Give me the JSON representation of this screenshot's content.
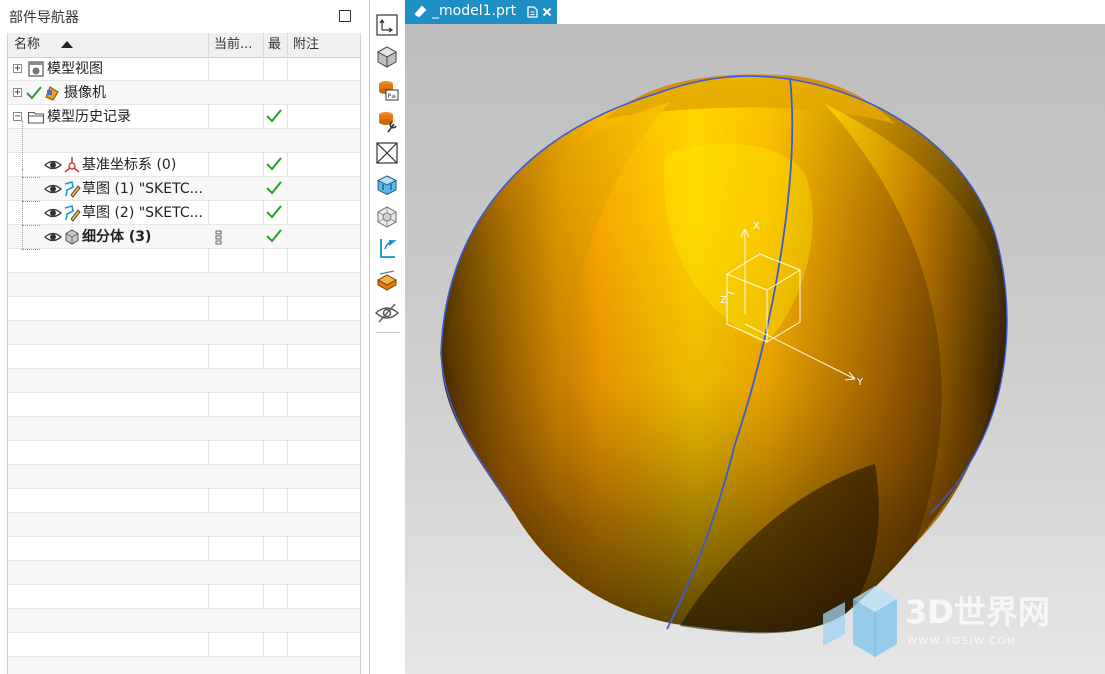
{
  "navigator": {
    "title": "部件导航器",
    "columns": [
      "名称",
      "当前...",
      "最",
      "附注"
    ],
    "rows": [
      {
        "label": "模型视图",
        "expander": "+",
        "icon": "model-views-icon",
        "checked": false
      },
      {
        "label": "摄像机",
        "expander": "+",
        "icon": "camera-icon",
        "checked": false
      },
      {
        "label": "模型历史记录",
        "expander": "−",
        "icon": "folder-icon",
        "checked": true
      },
      {
        "label": "基准坐标系 (0)",
        "icon": "datum-csys-icon",
        "checked": true
      },
      {
        "label": "草图 (1) \"SKETC...",
        "icon": "sketch-icon",
        "checked": true
      },
      {
        "label": "草图 (2) \"SKETC...",
        "icon": "sketch-icon",
        "checked": true
      },
      {
        "label": "细分体 (3)",
        "icon": "subdivision-body-icon",
        "checked": true,
        "bold": true
      }
    ]
  },
  "toolbar": {
    "buttons": [
      "orient-view-icon",
      "shaded-view-icon",
      "part-file-icon",
      "edit-settings-icon",
      "hide-icon",
      "view-triad-icon",
      "wireframe-icon",
      "undo-orient-icon",
      "section-view-icon",
      "show-hide-icon"
    ]
  },
  "tab": {
    "label": "_model1.prt",
    "accent": "#1d8fc4"
  },
  "viewport": {
    "axis_labels": {
      "x": "X",
      "y": "Y",
      "z": "Z"
    },
    "body_color": "#f5a300",
    "edge_color": "#3a5ad8"
  },
  "watermark": {
    "text": "3D世界网",
    "url": "WWW.3DSJW.COM"
  }
}
